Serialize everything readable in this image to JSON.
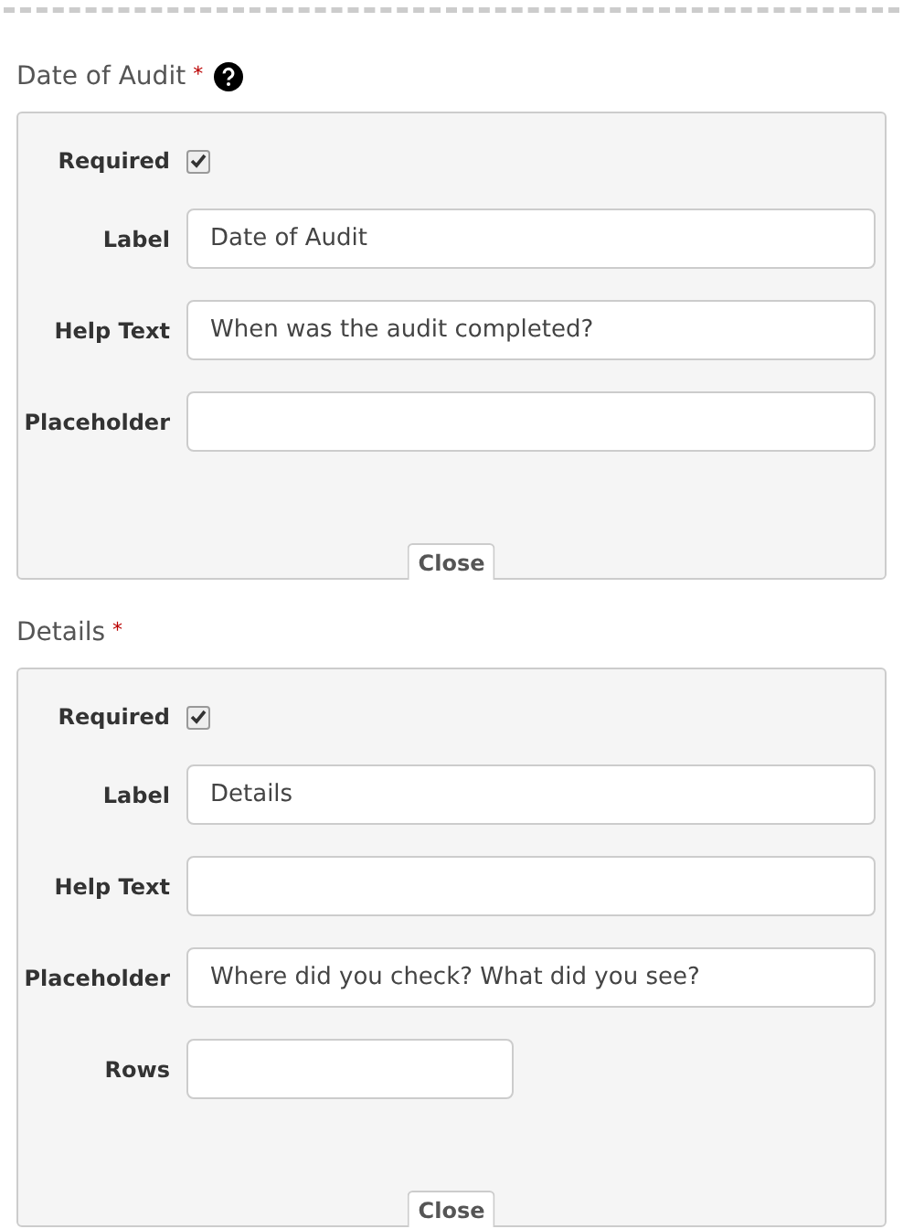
{
  "sections": [
    {
      "title": "Date of Audit",
      "required_mark": "*",
      "help": true,
      "fields": [
        {
          "kind": "checkbox",
          "label": "Required",
          "checked": true
        },
        {
          "kind": "text",
          "label": "Label",
          "value": "Date of Audit"
        },
        {
          "kind": "text",
          "label": "Help Text",
          "value": "When was the audit completed?"
        },
        {
          "kind": "text",
          "label": "Placeholder"
        }
      ],
      "close": "Close"
    },
    {
      "title": "Details",
      "required_mark": "*",
      "help": false,
      "fields": [
        {
          "kind": "checkbox",
          "label": "Required",
          "checked": true
        },
        {
          "kind": "text",
          "label": "Label",
          "value": "Details"
        },
        {
          "kind": "text",
          "label": "Help Text"
        },
        {
          "kind": "text",
          "label": "Placeholder",
          "value": "Where did you check? What did you see?"
        },
        {
          "kind": "short",
          "label": "Rows"
        }
      ],
      "close": "Close"
    }
  ]
}
